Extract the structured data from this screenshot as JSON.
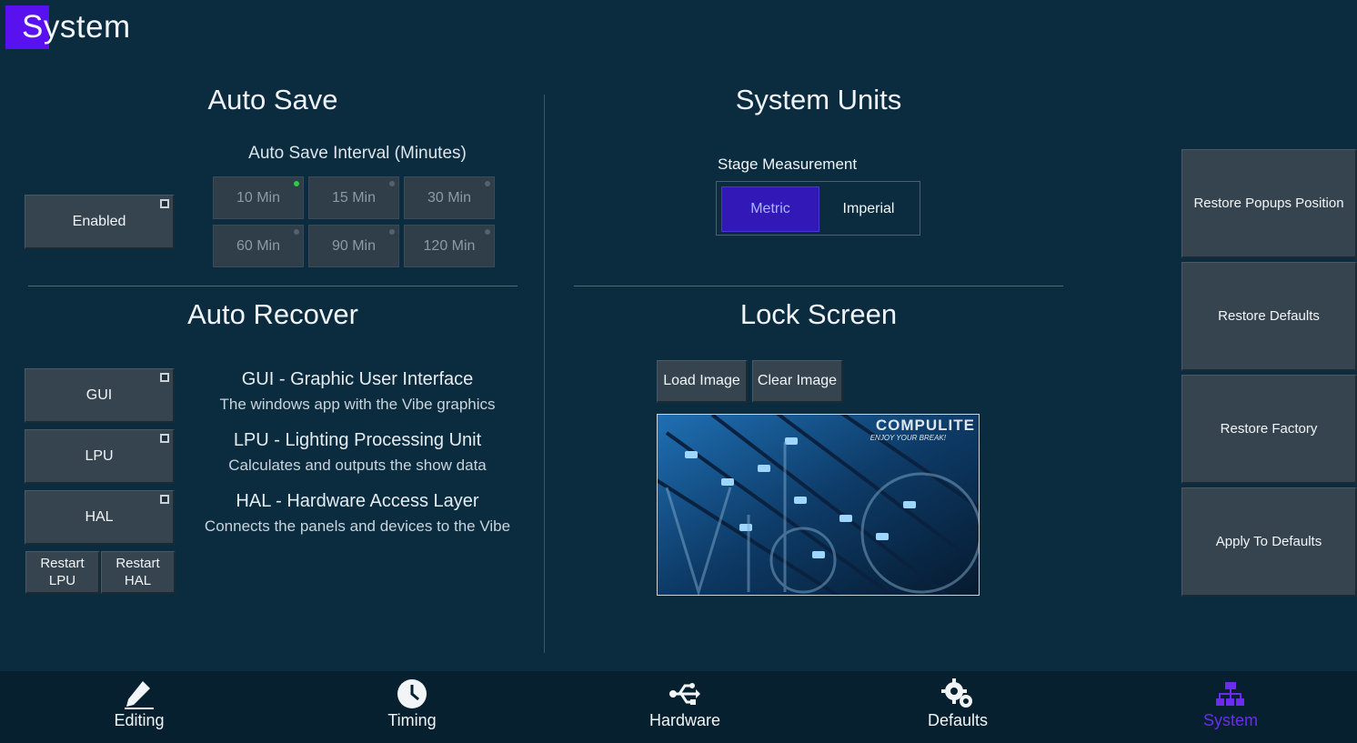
{
  "page": {
    "title": "System"
  },
  "auto_save": {
    "heading": "Auto Save",
    "enabled_label": "Enabled",
    "interval_label": "Auto Save Interval (Minutes)",
    "intervals": [
      "10 Min",
      "15 Min",
      "30 Min",
      "60 Min",
      "90 Min",
      "120 Min"
    ],
    "selected_interval": "10 Min"
  },
  "auto_recover": {
    "heading": "Auto Recover",
    "toggles": [
      "GUI",
      "LPU",
      "HAL"
    ],
    "restart_lpu": [
      "Restart",
      "LPU"
    ],
    "restart_hal": [
      "Restart",
      "HAL"
    ],
    "descriptions": [
      {
        "title": "GUI - Graphic User Interface",
        "sub": "The windows app with the Vibe graphics"
      },
      {
        "title": "LPU - Lighting Processing Unit",
        "sub": "Calculates and outputs the show data"
      },
      {
        "title": "HAL - Hardware Access Layer",
        "sub": "Connects the panels and devices to the Vibe"
      }
    ]
  },
  "system_units": {
    "heading": "System Units",
    "label": "Stage Measurement",
    "options": [
      "Metric",
      "Imperial"
    ],
    "selected": "Metric"
  },
  "lock_screen": {
    "heading": "Lock Screen",
    "load_label": "Load Image",
    "clear_label": "Clear Image",
    "image": {
      "brand": "COMPULITE",
      "tagline": "ENJOY YOUR BREAK!",
      "watermark": "vibe"
    }
  },
  "side_actions": [
    "Restore Popups Position",
    "Restore Defaults",
    "Restore Factory",
    "Apply To Defaults"
  ],
  "nav": {
    "items": [
      {
        "label": "Editing",
        "icon": "pencil-icon"
      },
      {
        "label": "Timing",
        "icon": "clock-icon"
      },
      {
        "label": "Hardware",
        "icon": "usb-icon"
      },
      {
        "label": "Defaults",
        "icon": "gears-icon"
      },
      {
        "label": "System",
        "icon": "network-icon"
      }
    ],
    "active": "System"
  },
  "colors": {
    "background": "#0b2b3f",
    "accent": "#5a11f0",
    "selected_unit": "#3318b8",
    "active_indicator": "#2ecc40"
  }
}
